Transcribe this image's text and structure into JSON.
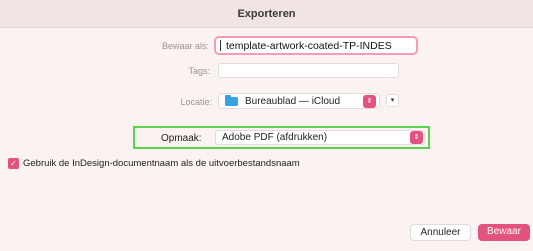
{
  "dialog": {
    "title": "Exporteren"
  },
  "save_as": {
    "label": "Bewaar als:",
    "value": "template-artwork-coated-TP-INDES"
  },
  "tags": {
    "label": "Tags:",
    "value": ""
  },
  "location": {
    "label": "Locatie:",
    "value": "Bureaublad — iCloud"
  },
  "format": {
    "label": "Opmaak:",
    "value": "Adobe PDF (afdrukken)"
  },
  "checkbox": {
    "label": "Gebruik de InDesign-documentnaam als de uitvoerbestandsnaam",
    "checked": true
  },
  "buttons": {
    "cancel": "Annuleer",
    "save": "Bewaar"
  },
  "colors": {
    "accent": "#e2537f",
    "highlight_field": "#f29db4",
    "format_highlight": "#5ad44a",
    "folder": "#39a2e3"
  },
  "icons": {
    "location_folder": "folder-icon",
    "stepper": "up-down-chevron-icon",
    "expand": "chevron-down-icon",
    "checkmark": "checkmark-icon"
  }
}
